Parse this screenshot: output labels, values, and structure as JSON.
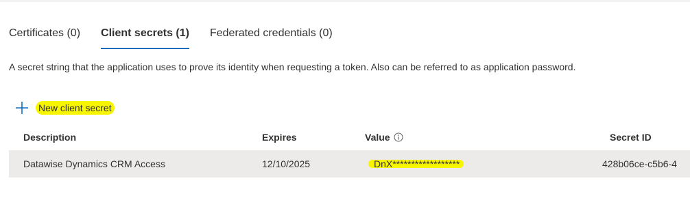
{
  "tabs": [
    {
      "label": "Certificates (0)"
    },
    {
      "label": "Client secrets (1)"
    },
    {
      "label": "Federated credentials (0)"
    }
  ],
  "description": "A secret string that the application uses to prove its identity when requesting a token. Also can be referred to as application password.",
  "new_secret_label": "New client secret",
  "table": {
    "headers": {
      "description": "Description",
      "expires": "Expires",
      "value": "Value",
      "secret_id": "Secret ID"
    },
    "rows": [
      {
        "description": "Datawise Dynamics CRM Access",
        "expires": "12/10/2025",
        "value": "DnX******************",
        "secret_id": "428b06ce-c5b6-4"
      }
    ]
  },
  "colors": {
    "accent": "#0f6cbd",
    "highlight": "#f8f500",
    "row_bg": "#edebe9"
  },
  "icons": {
    "add": "plus-icon",
    "info": "info-icon"
  }
}
